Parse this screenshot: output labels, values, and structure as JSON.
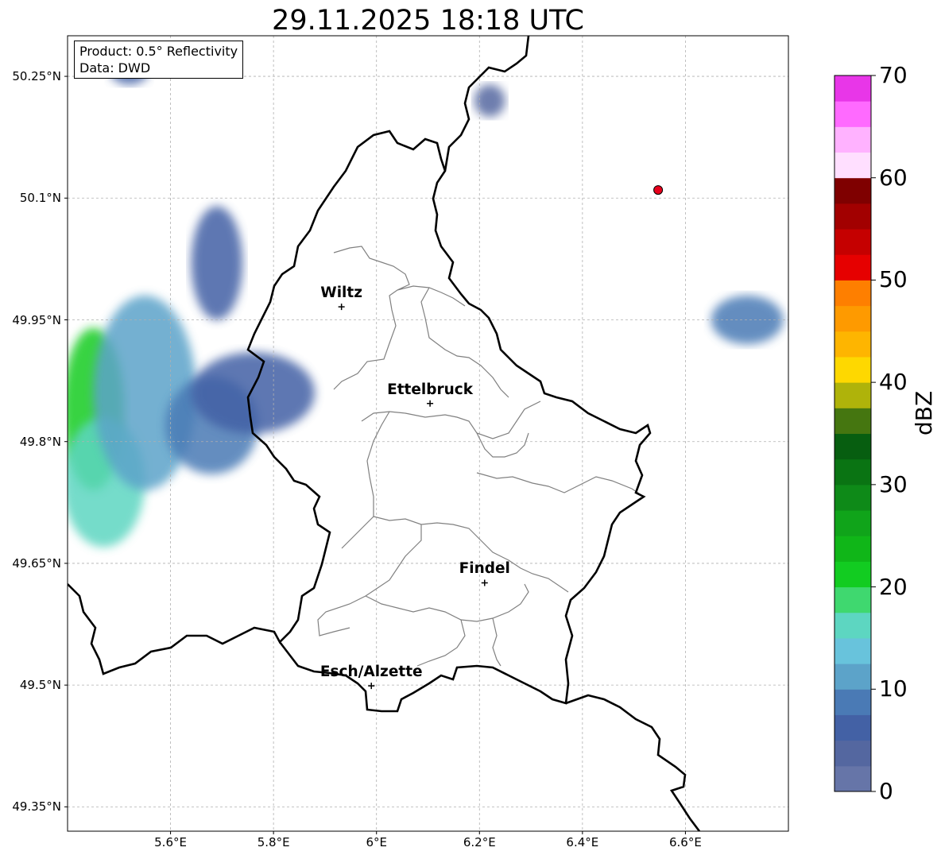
{
  "title": "29.11.2025 18:18 UTC",
  "info_box": {
    "line1": "Product: 0.5° Reflectivity",
    "line2": "Data: DWD"
  },
  "axes": {
    "lon_range": [
      5.4,
      6.8
    ],
    "lat_range": [
      49.32,
      50.3
    ],
    "lat_ticks": [
      {
        "value": 50.25,
        "label": "50.25°N"
      },
      {
        "value": 50.1,
        "label": "50.1°N"
      },
      {
        "value": 49.95,
        "label": "49.95°N"
      },
      {
        "value": 49.8,
        "label": "49.8°N"
      },
      {
        "value": 49.65,
        "label": "49.65°N"
      },
      {
        "value": 49.5,
        "label": "49.5°N"
      },
      {
        "value": 49.35,
        "label": "49.35°N"
      }
    ],
    "lon_ticks": [
      {
        "value": 5.6,
        "label": "5.6°E"
      },
      {
        "value": 5.8,
        "label": "5.8°E"
      },
      {
        "value": 6.0,
        "label": "6°E"
      },
      {
        "value": 6.2,
        "label": "6.2°E"
      },
      {
        "value": 6.4,
        "label": "6.4°E"
      },
      {
        "value": 6.6,
        "label": "6.6°E"
      }
    ],
    "grid": true
  },
  "cities": [
    {
      "name": "Wiltz",
      "lon": 5.932,
      "lat": 49.966
    },
    {
      "name": "Ettelbruck",
      "lon": 6.104,
      "lat": 49.847
    },
    {
      "name": "Findel",
      "lon": 6.21,
      "lat": 49.626
    },
    {
      "name": "Esch/Alzette",
      "lon": 5.99,
      "lat": 49.499
    }
  ],
  "radar_site": {
    "lon": 6.547,
    "lat": 50.11,
    "color": "#e8001c"
  },
  "colorbar": {
    "label": "dBZ",
    "min": 0,
    "max": 70,
    "ticks": [
      {
        "value": 0,
        "label": "0"
      },
      {
        "value": 10,
        "label": "10"
      },
      {
        "value": 20,
        "label": "20"
      },
      {
        "value": 30,
        "label": "30"
      },
      {
        "value": 40,
        "label": "40"
      },
      {
        "value": 50,
        "label": "50"
      },
      {
        "value": 60,
        "label": "60"
      },
      {
        "value": 70,
        "label": "70"
      }
    ],
    "colors": [
      "#6675a8",
      "#5467a0",
      "#4361a5",
      "#4a7ab5",
      "#5ca3c9",
      "#68c3dc",
      "#5dd6c1",
      "#3fd86f",
      "#12cc21",
      "#10b618",
      "#10a41a",
      "#0e8a18",
      "#0a7413",
      "#075e10",
      "#457610",
      "#afb30a",
      "#fed800",
      "#feb500",
      "#fe9a00",
      "#fe7f00",
      "#e60000",
      "#c50000",
      "#a20000",
      "#7f0000",
      "#ffdfff",
      "#ffb2ff",
      "#ff6aff",
      "#e836e8"
    ]
  },
  "precip_areas": [
    {
      "lon": 5.45,
      "lat": 49.84,
      "rx": 0.06,
      "ry": 0.1,
      "dbz": 22
    },
    {
      "lon": 5.47,
      "lat": 49.75,
      "rx": 0.08,
      "ry": 0.08,
      "dbz": 17
    },
    {
      "lon": 5.55,
      "lat": 49.86,
      "rx": 0.1,
      "ry": 0.12,
      "dbz": 12
    },
    {
      "lon": 5.68,
      "lat": 49.82,
      "rx": 0.09,
      "ry": 0.06,
      "dbz": 8
    },
    {
      "lon": 5.76,
      "lat": 49.86,
      "rx": 0.12,
      "ry": 0.05,
      "dbz": 6
    },
    {
      "lon": 5.69,
      "lat": 50.02,
      "rx": 0.05,
      "ry": 0.07,
      "dbz": 5
    },
    {
      "lon": 5.52,
      "lat": 50.26,
      "rx": 0.04,
      "ry": 0.02,
      "dbz": 5
    },
    {
      "lon": 6.72,
      "lat": 49.95,
      "rx": 0.07,
      "ry": 0.03,
      "dbz": 9
    },
    {
      "lon": 6.22,
      "lat": 50.22,
      "rx": 0.03,
      "ry": 0.02,
      "dbz": 4
    }
  ]
}
